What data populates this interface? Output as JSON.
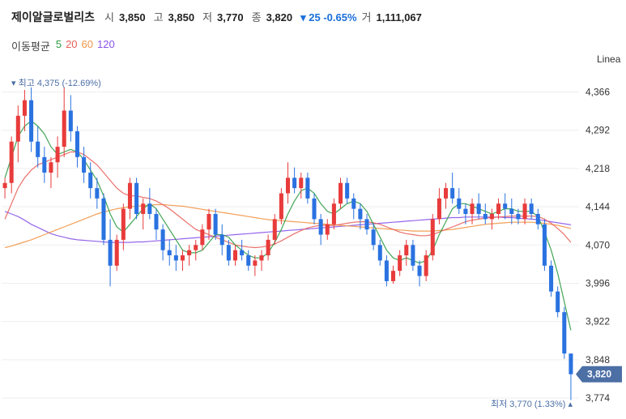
{
  "header": {
    "name": "제이알글로벌리츠",
    "open_label": "시",
    "open": "3,850",
    "high_label": "고",
    "high": "3,850",
    "low_label": "저",
    "low": "3,770",
    "close_label": "종",
    "close": "3,820",
    "change": "▾ 25 -0.65%",
    "volume_label": "거",
    "volume": "1,111,067"
  },
  "ma_legend": {
    "title": "이동평균",
    "items": [
      {
        "label": "5",
        "color": "#2e9b44"
      },
      {
        "label": "20",
        "color": "#e8605a"
      },
      {
        "label": "60",
        "color": "#f29545"
      },
      {
        "label": "120",
        "color": "#8a55e8"
      }
    ]
  },
  "scale_mode": "Linea",
  "colors": {
    "up": "#e83b3b",
    "down": "#2a72e0",
    "grid": "#eeeeee",
    "price_tag": "#4c6fa5"
  },
  "chart_data": {
    "type": "candlestick",
    "ylim": [
      3760,
      4395
    ],
    "yticks": [
      4366,
      4292,
      4218,
      4144,
      4070,
      3996,
      3922,
      3848,
      3774
    ],
    "tick_labels": [
      "4,366",
      "4,292",
      "4,218",
      "4,144",
      "4,070",
      "3,996",
      "3,922",
      "3,848",
      "3,774"
    ],
    "last_price_label": "3,820",
    "last_price": 3820,
    "max_annotation": "▾ 최고 4,375 (-12.69%)",
    "min_annotation": "최저 3,770 (1.33%) ▴",
    "candles": [
      [
        4180,
        4200,
        4160,
        4190
      ],
      [
        4190,
        4280,
        4170,
        4270
      ],
      [
        4270,
        4340,
        4230,
        4320
      ],
      [
        4320,
        4370,
        4290,
        4350
      ],
      [
        4350,
        4375,
        4250,
        4270
      ],
      [
        4270,
        4300,
        4220,
        4240
      ],
      [
        4240,
        4260,
        4190,
        4210
      ],
      [
        4210,
        4240,
        4180,
        4230
      ],
      [
        4230,
        4280,
        4200,
        4260
      ],
      [
        4260,
        4375,
        4240,
        4330
      ],
      [
        4330,
        4360,
        4270,
        4290
      ],
      [
        4290,
        4300,
        4220,
        4240
      ],
      [
        4240,
        4260,
        4190,
        4210
      ],
      [
        4210,
        4230,
        4160,
        4180
      ],
      [
        4180,
        4200,
        4140,
        4160
      ],
      [
        4160,
        4170,
        4070,
        4080
      ],
      [
        4080,
        4120,
        3990,
        4030
      ],
      [
        4030,
        4090,
        4020,
        4080
      ],
      [
        4080,
        4150,
        4060,
        4140
      ],
      [
        4140,
        4200,
        4120,
        4190
      ],
      [
        4190,
        4200,
        4120,
        4130
      ],
      [
        4130,
        4160,
        4100,
        4150
      ],
      [
        4150,
        4180,
        4120,
        4130
      ],
      [
        4130,
        4140,
        4080,
        4100
      ],
      [
        4100,
        4110,
        4040,
        4060
      ],
      [
        4060,
        4080,
        4030,
        4050
      ],
      [
        4050,
        4070,
        4020,
        4040
      ],
      [
        4040,
        4060,
        4020,
        4050
      ],
      [
        4050,
        4070,
        4030,
        4060
      ],
      [
        4060,
        4080,
        4040,
        4070
      ],
      [
        4070,
        4110,
        4060,
        4100
      ],
      [
        4100,
        4140,
        4080,
        4130
      ],
      [
        4130,
        4140,
        4080,
        4090
      ],
      [
        4090,
        4110,
        4050,
        4070
      ],
      [
        4070,
        4080,
        4030,
        4040
      ],
      [
        4040,
        4070,
        4030,
        4060
      ],
      [
        4060,
        4080,
        4040,
        4050
      ],
      [
        4050,
        4060,
        4020,
        4030
      ],
      [
        4030,
        4050,
        4010,
        4040
      ],
      [
        4040,
        4060,
        4020,
        4050
      ],
      [
        4050,
        4090,
        4040,
        4080
      ],
      [
        4080,
        4130,
        4070,
        4120
      ],
      [
        4120,
        4180,
        4110,
        4170
      ],
      [
        4170,
        4230,
        4150,
        4200
      ],
      [
        4200,
        4220,
        4170,
        4180
      ],
      [
        4180,
        4210,
        4160,
        4200
      ],
      [
        4200,
        4210,
        4150,
        4160
      ],
      [
        4160,
        4170,
        4110,
        4120
      ],
      [
        4120,
        4130,
        4070,
        4090
      ],
      [
        4090,
        4120,
        4080,
        4110
      ],
      [
        4110,
        4160,
        4100,
        4150
      ],
      [
        4150,
        4200,
        4140,
        4190
      ],
      [
        4190,
        4200,
        4150,
        4160
      ],
      [
        4160,
        4170,
        4120,
        4140
      ],
      [
        4140,
        4150,
        4100,
        4120
      ],
      [
        4120,
        4130,
        4090,
        4100
      ],
      [
        4100,
        4110,
        4060,
        4070
      ],
      [
        4070,
        4080,
        4030,
        4040
      ],
      [
        4040,
        4050,
        3990,
        4000
      ],
      [
        4000,
        4030,
        3995,
        4020
      ],
      [
        4020,
        4060,
        4010,
        4050
      ],
      [
        4050,
        4080,
        4030,
        4070
      ],
      [
        4070,
        4080,
        4020,
        4030
      ],
      [
        4030,
        4040,
        3990,
        4010
      ],
      [
        4010,
        4060,
        4000,
        4050
      ],
      [
        4050,
        4130,
        4040,
        4120
      ],
      [
        4120,
        4180,
        4110,
        4160
      ],
      [
        4160,
        4190,
        4140,
        4180
      ],
      [
        4180,
        4210,
        4150,
        4160
      ],
      [
        4160,
        4180,
        4130,
        4140
      ],
      [
        4140,
        4150,
        4110,
        4130
      ],
      [
        4130,
        4160,
        4110,
        4150
      ],
      [
        4150,
        4170,
        4120,
        4130
      ],
      [
        4130,
        4150,
        4110,
        4120
      ],
      [
        4120,
        4140,
        4100,
        4130
      ],
      [
        4130,
        4160,
        4120,
        4150
      ],
      [
        4150,
        4170,
        4120,
        4140
      ],
      [
        4140,
        4160,
        4110,
        4130
      ],
      [
        4130,
        4140,
        4110,
        4120
      ],
      [
        4120,
        4160,
        4110,
        4150
      ],
      [
        4150,
        4160,
        4120,
        4130
      ],
      [
        4130,
        4140,
        4100,
        4110
      ],
      [
        4110,
        4120,
        4020,
        4030
      ],
      [
        4030,
        4040,
        3970,
        3980
      ],
      [
        3980,
        3990,
        3930,
        3940
      ],
      [
        3940,
        3950,
        3850,
        3860
      ],
      [
        3860,
        3850,
        3770,
        3820
      ]
    ],
    "ma5": [
      4200,
      4240,
      4280,
      4300,
      4310,
      4300,
      4285,
      4260,
      4245,
      4250,
      4255,
      4250,
      4235,
      4215,
      4195,
      4165,
      4130,
      4105,
      4095,
      4110,
      4125,
      4140,
      4150,
      4140,
      4120,
      4100,
      4080,
      4060,
      4055,
      4055,
      4060,
      4075,
      4090,
      4090,
      4085,
      4070,
      4060,
      4050,
      4045,
      4045,
      4055,
      4075,
      4100,
      4130,
      4155,
      4175,
      4180,
      4170,
      4150,
      4135,
      4130,
      4140,
      4150,
      4155,
      4150,
      4135,
      4110,
      4085,
      4060,
      4045,
      4040,
      4045,
      4040,
      4035,
      4040,
      4060,
      4090,
      4115,
      4140,
      4150,
      4150,
      4145,
      4140,
      4135,
      4130,
      4135,
      4140,
      4140,
      4135,
      4135,
      4135,
      4125,
      4095,
      4060,
      4015,
      3960,
      3905
    ],
    "ma20": [
      4120,
      4150,
      4180,
      4200,
      4215,
      4225,
      4230,
      4235,
      4240,
      4245,
      4250,
      4250,
      4245,
      4235,
      4225,
      4210,
      4195,
      4180,
      4170,
      4165,
      4165,
      4162,
      4160,
      4155,
      4148,
      4140,
      4130,
      4120,
      4110,
      4100,
      4095,
      4090,
      4085,
      4080,
      4075,
      4070,
      4068,
      4066,
      4065,
      4066,
      4068,
      4072,
      4078,
      4085,
      4092,
      4098,
      4103,
      4106,
      4108,
      4108,
      4108,
      4110,
      4112,
      4114,
      4115,
      4115,
      4113,
      4110,
      4105,
      4100,
      4095,
      4092,
      4090,
      4088,
      4088,
      4090,
      4095,
      4100,
      4105,
      4110,
      4115,
      4118,
      4120,
      4122,
      4123,
      4124,
      4125,
      4126,
      4126,
      4126,
      4126,
      4125,
      4120,
      4112,
      4102,
      4090,
      4075
    ],
    "ma60": [
      4065,
      4068,
      4072,
      4076,
      4080,
      4085,
      4090,
      4095,
      4100,
      4105,
      4110,
      4115,
      4120,
      4125,
      4130,
      4134,
      4137,
      4140,
      4142,
      4144,
      4145,
      4146,
      4147,
      4148,
      4148,
      4147,
      4146,
      4145,
      4143,
      4141,
      4139,
      4137,
      4135,
      4133,
      4131,
      4129,
      4127,
      4125,
      4123,
      4121,
      4119,
      4118,
      4117,
      4116,
      4115,
      4114,
      4113,
      4112,
      4111,
      4110,
      4109,
      4108,
      4107,
      4106,
      4105,
      4104,
      4103,
      4102,
      4101,
      4100,
      4099,
      4098,
      4097,
      4097,
      4097,
      4097,
      4098,
      4099,
      4100,
      4102,
      4104,
      4106,
      4108,
      4110,
      4111,
      4112,
      4113,
      4114,
      4114,
      4114,
      4114,
      4113,
      4112,
      4110,
      4108,
      4105,
      4102
    ],
    "ma120": [
      4135,
      4130,
      4125,
      4118,
      4110,
      4104,
      4098,
      4092,
      4088,
      4085,
      4082,
      4080,
      4079,
      4078,
      4077,
      4076,
      4075,
      4075,
      4075,
      4075,
      4076,
      4076,
      4077,
      4078,
      4079,
      4080,
      4081,
      4082,
      4083,
      4084,
      4085,
      4086,
      4087,
      4088,
      4089,
      4090,
      4091,
      4092,
      4093,
      4094,
      4095,
      4096,
      4097,
      4098,
      4099,
      4100,
      4101,
      4102,
      4103,
      4104,
      4105,
      4106,
      4107,
      4108,
      4109,
      4110,
      4111,
      4112,
      4113,
      4114,
      4115,
      4116,
      4117,
      4118,
      4119,
      4120,
      4121,
      4122,
      4123,
      4123,
      4124,
      4124,
      4124,
      4124,
      4124,
      4124,
      4123,
      4123,
      4122,
      4121,
      4120,
      4119,
      4117,
      4115,
      4113,
      4111,
      4109
    ]
  }
}
